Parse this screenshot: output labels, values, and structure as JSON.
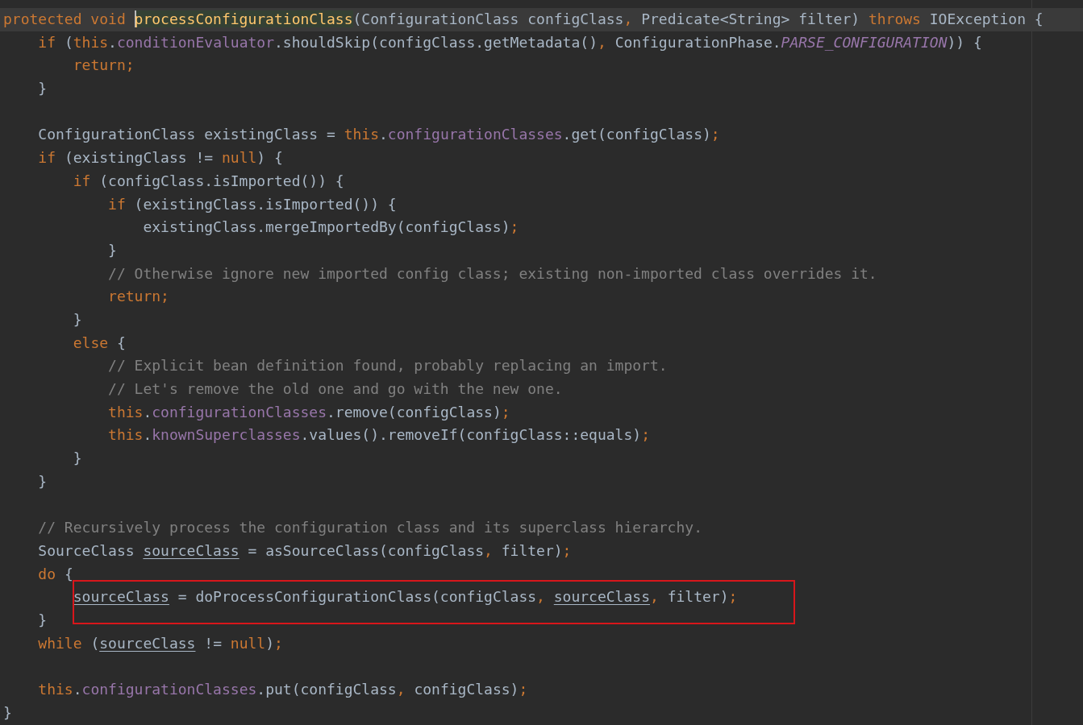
{
  "editor": {
    "lines": [
      {
        "current": true,
        "boxed": false,
        "tokens": [
          {
            "kind": "keyword",
            "text": "protected void "
          },
          {
            "kind": "declaration_at_caret",
            "text": "processConfigurationClass"
          },
          {
            "kind": "plain",
            "text": "(ConfigurationClass configClass"
          },
          {
            "kind": "keyword",
            "text": ", "
          },
          {
            "kind": "plain",
            "text": "Predicate<String> filter) "
          },
          {
            "kind": "keyword",
            "text": "throws "
          },
          {
            "kind": "plain",
            "text": "IOException {"
          }
        ]
      },
      {
        "current": false,
        "boxed": false,
        "tokens": [
          {
            "kind": "keyword",
            "text": "    if "
          },
          {
            "kind": "plain",
            "text": "("
          },
          {
            "kind": "keyword",
            "text": "this"
          },
          {
            "kind": "plain",
            "text": "."
          },
          {
            "kind": "field",
            "text": "conditionEvaluator"
          },
          {
            "kind": "plain",
            "text": ".shouldSkip(configClass.getMetadata()"
          },
          {
            "kind": "keyword",
            "text": ", "
          },
          {
            "kind": "plain",
            "text": "ConfigurationPhase."
          },
          {
            "kind": "constant",
            "text": "PARSE_CONFIGURATION"
          },
          {
            "kind": "plain",
            "text": ")) {"
          }
        ]
      },
      {
        "current": false,
        "boxed": false,
        "tokens": [
          {
            "kind": "keyword",
            "text": "        return;"
          }
        ]
      },
      {
        "current": false,
        "boxed": false,
        "tokens": [
          {
            "kind": "plain",
            "text": "    }"
          }
        ]
      },
      {
        "current": false,
        "boxed": false
      },
      {
        "current": false,
        "boxed": false,
        "tokens": [
          {
            "kind": "plain",
            "text": "    ConfigurationClass existingClass = "
          },
          {
            "kind": "keyword",
            "text": "this"
          },
          {
            "kind": "plain",
            "text": "."
          },
          {
            "kind": "field",
            "text": "configurationClasses"
          },
          {
            "kind": "plain",
            "text": ".get(configClass)"
          },
          {
            "kind": "keyword",
            "text": ";"
          }
        ]
      },
      {
        "current": false,
        "boxed": false,
        "tokens": [
          {
            "kind": "keyword",
            "text": "    if "
          },
          {
            "kind": "plain",
            "text": "(existingClass != "
          },
          {
            "kind": "keyword",
            "text": "null"
          },
          {
            "kind": "plain",
            "text": ") {"
          }
        ]
      },
      {
        "current": false,
        "boxed": false,
        "tokens": [
          {
            "kind": "keyword",
            "text": "        if "
          },
          {
            "kind": "plain",
            "text": "(configClass.isImported()) {"
          }
        ]
      },
      {
        "current": false,
        "boxed": false,
        "tokens": [
          {
            "kind": "keyword",
            "text": "            if "
          },
          {
            "kind": "plain",
            "text": "(existingClass.isImported()) {"
          }
        ]
      },
      {
        "current": false,
        "boxed": false,
        "tokens": [
          {
            "kind": "plain",
            "text": "                existingClass.mergeImportedBy(configClass)"
          },
          {
            "kind": "keyword",
            "text": ";"
          }
        ]
      },
      {
        "current": false,
        "boxed": false,
        "tokens": [
          {
            "kind": "plain",
            "text": "            }"
          }
        ]
      },
      {
        "current": false,
        "boxed": false,
        "tokens": [
          {
            "kind": "comment",
            "text": "            // Otherwise ignore new imported config class; existing non-imported class overrides it."
          }
        ]
      },
      {
        "current": false,
        "boxed": false,
        "tokens": [
          {
            "kind": "keyword",
            "text": "            return;"
          }
        ]
      },
      {
        "current": false,
        "boxed": false,
        "tokens": [
          {
            "kind": "plain",
            "text": "        }"
          }
        ]
      },
      {
        "current": false,
        "boxed": false,
        "tokens": [
          {
            "kind": "keyword",
            "text": "        else "
          },
          {
            "kind": "plain",
            "text": "{"
          }
        ]
      },
      {
        "current": false,
        "boxed": false,
        "tokens": [
          {
            "kind": "comment",
            "text": "            // Explicit bean definition found, probably replacing an import."
          }
        ]
      },
      {
        "current": false,
        "boxed": false,
        "tokens": [
          {
            "kind": "comment",
            "text": "            // Let's remove the old one and go with the new one."
          }
        ]
      },
      {
        "current": false,
        "boxed": false,
        "tokens": [
          {
            "kind": "keyword",
            "text": "            this"
          },
          {
            "kind": "plain",
            "text": "."
          },
          {
            "kind": "field",
            "text": "configurationClasses"
          },
          {
            "kind": "plain",
            "text": ".remove(configClass)"
          },
          {
            "kind": "keyword",
            "text": ";"
          }
        ]
      },
      {
        "current": false,
        "boxed": false,
        "tokens": [
          {
            "kind": "keyword",
            "text": "            this"
          },
          {
            "kind": "plain",
            "text": "."
          },
          {
            "kind": "field",
            "text": "knownSuperclasses"
          },
          {
            "kind": "plain",
            "text": ".values().removeIf(configClass::equals)"
          },
          {
            "kind": "keyword",
            "text": ";"
          }
        ]
      },
      {
        "current": false,
        "boxed": false,
        "tokens": [
          {
            "kind": "plain",
            "text": "        }"
          }
        ]
      },
      {
        "current": false,
        "boxed": false,
        "tokens": [
          {
            "kind": "plain",
            "text": "    }"
          }
        ]
      },
      {
        "current": false,
        "boxed": false
      },
      {
        "current": false,
        "boxed": false,
        "tokens": [
          {
            "kind": "comment",
            "text": "    // Recursively process the configuration class and its superclass hierarchy."
          }
        ]
      },
      {
        "current": false,
        "boxed": false,
        "tokens": [
          {
            "kind": "plain",
            "text": "    SourceClass "
          },
          {
            "kind": "reassigned",
            "text": "sourceClass"
          },
          {
            "kind": "plain",
            "text": " = asSourceClass(configClass"
          },
          {
            "kind": "keyword",
            "text": ", "
          },
          {
            "kind": "plain",
            "text": "filter)"
          },
          {
            "kind": "keyword",
            "text": ";"
          }
        ]
      },
      {
        "current": false,
        "boxed": false,
        "tokens": [
          {
            "kind": "keyword",
            "text": "    do "
          },
          {
            "kind": "plain",
            "text": "{"
          }
        ]
      },
      {
        "current": false,
        "boxed": true,
        "tokens": [
          {
            "kind": "reassigned",
            "text": "        sourceClass"
          },
          {
            "kind": "plain",
            "text": " = doProcessConfigurationClass(configClass"
          },
          {
            "kind": "keyword",
            "text": ", "
          },
          {
            "kind": "reassigned",
            "text": "sourceClass"
          },
          {
            "kind": "keyword",
            "text": ", "
          },
          {
            "kind": "plain",
            "text": "filter)"
          },
          {
            "kind": "keyword",
            "text": ";"
          }
        ]
      },
      {
        "current": false,
        "boxed": false,
        "tokens": [
          {
            "kind": "plain",
            "text": "    }"
          }
        ]
      },
      {
        "current": false,
        "boxed": false,
        "tokens": [
          {
            "kind": "keyword",
            "text": "    while "
          },
          {
            "kind": "plain",
            "text": "("
          },
          {
            "kind": "reassigned",
            "text": "sourceClass"
          },
          {
            "kind": "plain",
            "text": " != "
          },
          {
            "kind": "keyword",
            "text": "null"
          },
          {
            "kind": "plain",
            "text": ")"
          },
          {
            "kind": "keyword",
            "text": ";"
          }
        ]
      },
      {
        "current": false,
        "boxed": false
      },
      {
        "current": false,
        "boxed": false,
        "tokens": [
          {
            "kind": "keyword",
            "text": "    this"
          },
          {
            "kind": "plain",
            "text": "."
          },
          {
            "kind": "field",
            "text": "configurationClasses"
          },
          {
            "kind": "plain",
            "text": ".put(configClass"
          },
          {
            "kind": "keyword",
            "text": ", "
          },
          {
            "kind": "plain",
            "text": "configClass)"
          },
          {
            "kind": "keyword",
            "text": ";"
          }
        ]
      },
      {
        "current": false,
        "boxed": false,
        "tokens": [
          {
            "kind": "plain",
            "text": "}"
          }
        ]
      }
    ]
  }
}
